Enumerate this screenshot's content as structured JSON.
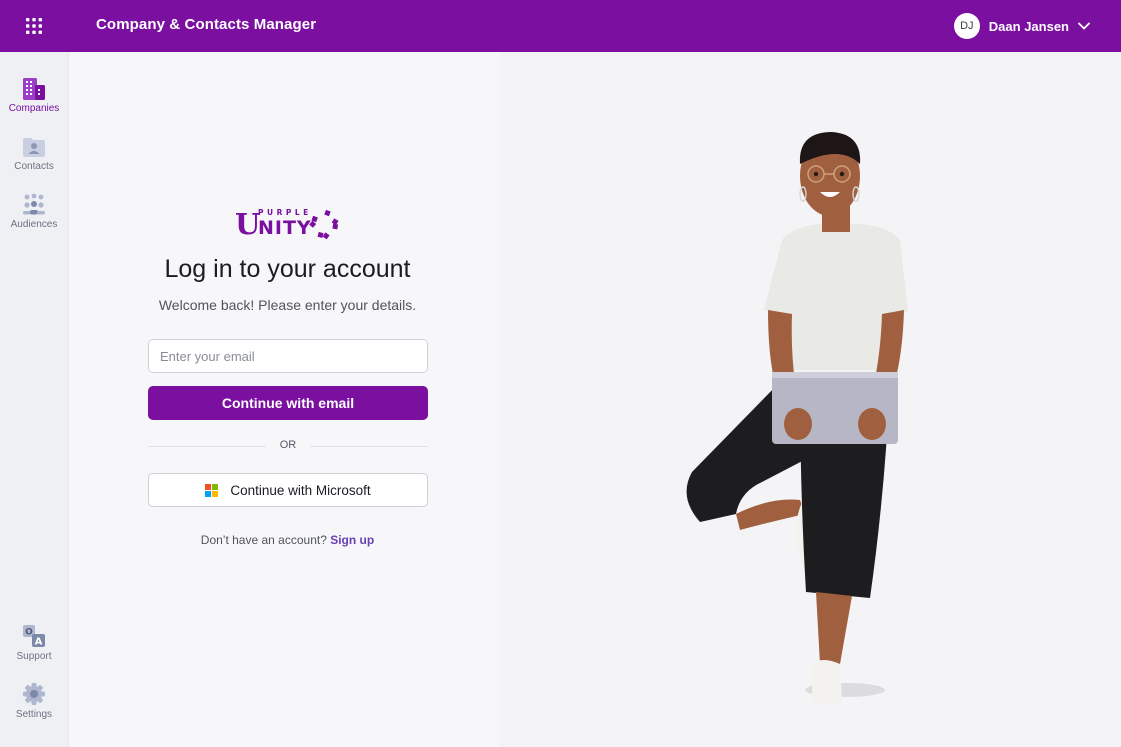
{
  "header": {
    "app_title": "Company & Contacts Manager",
    "user": {
      "initials": "DJ",
      "name": "Daan Jansen"
    }
  },
  "sidebar": {
    "items": [
      {
        "label": "Companies",
        "icon": "building-icon",
        "active": true
      },
      {
        "label": "Contacts",
        "icon": "contact-card-icon",
        "active": false
      },
      {
        "label": "Audiences",
        "icon": "audience-icon",
        "active": false
      }
    ],
    "bottom_items": [
      {
        "label": "Support",
        "icon": "translate-icon"
      },
      {
        "label": "Settings",
        "icon": "gear-icon"
      }
    ]
  },
  "login": {
    "logo": {
      "small_text": "PURPLE",
      "big_text": "UNITY"
    },
    "heading": "Log in to your account",
    "subheading": "Welcome back! Please enter your details.",
    "email_placeholder": "Enter your email",
    "email_button": "Continue with email",
    "divider": "OR",
    "microsoft_button": "Continue with Microsoft",
    "signup_prompt": "Don’t have an account?",
    "signup_link": "Sign up"
  },
  "colors": {
    "brand_purple": "#7a0fa0",
    "link_purple": "#6a3fb5",
    "sidebar_bg": "#eff0f4"
  }
}
